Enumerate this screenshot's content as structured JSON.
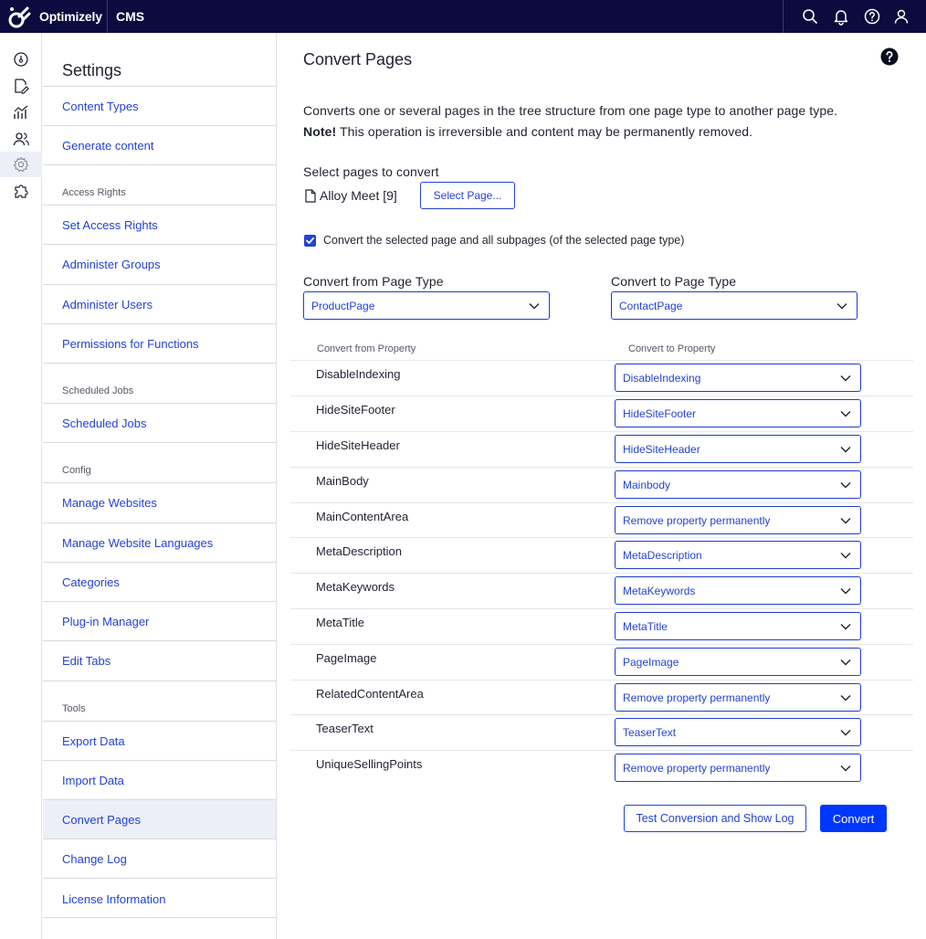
{
  "topbar": {
    "brand": "Optimizely",
    "product": "CMS",
    "icons": [
      "search-icon",
      "bell-icon",
      "help-circle-icon",
      "user-icon"
    ]
  },
  "rail": {
    "icons": [
      "dashboard-icon",
      "edit-icon",
      "reports-icon",
      "users-icon",
      "settings-icon",
      "addons-icon"
    ],
    "active": "settings-icon"
  },
  "nav": {
    "title": "Settings",
    "items": [
      {
        "type": "link",
        "label": "Content Types"
      },
      {
        "type": "link",
        "label": "Generate content"
      },
      {
        "type": "section",
        "label": "Access Rights"
      },
      {
        "type": "link",
        "label": "Set Access Rights"
      },
      {
        "type": "link",
        "label": "Administer Groups"
      },
      {
        "type": "link",
        "label": "Administer Users"
      },
      {
        "type": "link",
        "label": "Permissions for Functions"
      },
      {
        "type": "section",
        "label": "Scheduled Jobs"
      },
      {
        "type": "link",
        "label": "Scheduled Jobs"
      },
      {
        "type": "section",
        "label": "Config"
      },
      {
        "type": "link",
        "label": "Manage Websites"
      },
      {
        "type": "link",
        "label": "Manage Website Languages"
      },
      {
        "type": "link",
        "label": "Categories"
      },
      {
        "type": "link",
        "label": "Plug-in Manager"
      },
      {
        "type": "link",
        "label": "Edit Tabs"
      },
      {
        "type": "section",
        "label": "Tools"
      },
      {
        "type": "link",
        "label": "Export Data"
      },
      {
        "type": "link",
        "label": "Import Data"
      },
      {
        "type": "link",
        "label": "Convert Pages",
        "active": true
      },
      {
        "type": "link",
        "label": "Change Log"
      },
      {
        "type": "link",
        "label": "License Information"
      }
    ]
  },
  "main": {
    "title": "Convert Pages",
    "description": "Converts one or several pages in the tree structure from one page type to another page type.",
    "note_label": "Note!",
    "note_text": " This operation is irreversible and content may be permanently removed.",
    "select_pages_label": "Select pages to convert",
    "selected_page": "Alloy Meet [9]",
    "select_page_button": "Select Page...",
    "subpages_checkbox_label": "Convert the selected page and all subpages (of the selected page type)",
    "subpages_checked": true,
    "from_type_label": "Convert from Page Type",
    "from_type_value": "ProductPage",
    "to_type_label": "Convert to Page Type",
    "to_type_value": "ContactPage",
    "from_property_header": "Convert from Property",
    "to_property_header": "Convert to Property",
    "properties": [
      {
        "from": "DisableIndexing",
        "to": "DisableIndexing"
      },
      {
        "from": "HideSiteFooter",
        "to": "HideSiteFooter"
      },
      {
        "from": "HideSiteHeader",
        "to": "HideSiteHeader"
      },
      {
        "from": "MainBody",
        "to": "Mainbody"
      },
      {
        "from": "MainContentArea",
        "to": "Remove property permanently"
      },
      {
        "from": "MetaDescription",
        "to": "MetaDescription"
      },
      {
        "from": "MetaKeywords",
        "to": "MetaKeywords"
      },
      {
        "from": "MetaTitle",
        "to": "MetaTitle"
      },
      {
        "from": "PageImage",
        "to": "PageImage"
      },
      {
        "from": "RelatedContentArea",
        "to": "Remove property permanently"
      },
      {
        "from": "TeaserText",
        "to": "TeaserText"
      },
      {
        "from": "UniqueSellingPoints",
        "to": "Remove property permanently"
      }
    ],
    "test_button": "Test Conversion and Show Log",
    "convert_button": "Convert"
  },
  "colors": {
    "topbar": "#0b0b40",
    "link": "#2342d6",
    "primary": "#0037ff",
    "active_bg": "#eceef8"
  }
}
